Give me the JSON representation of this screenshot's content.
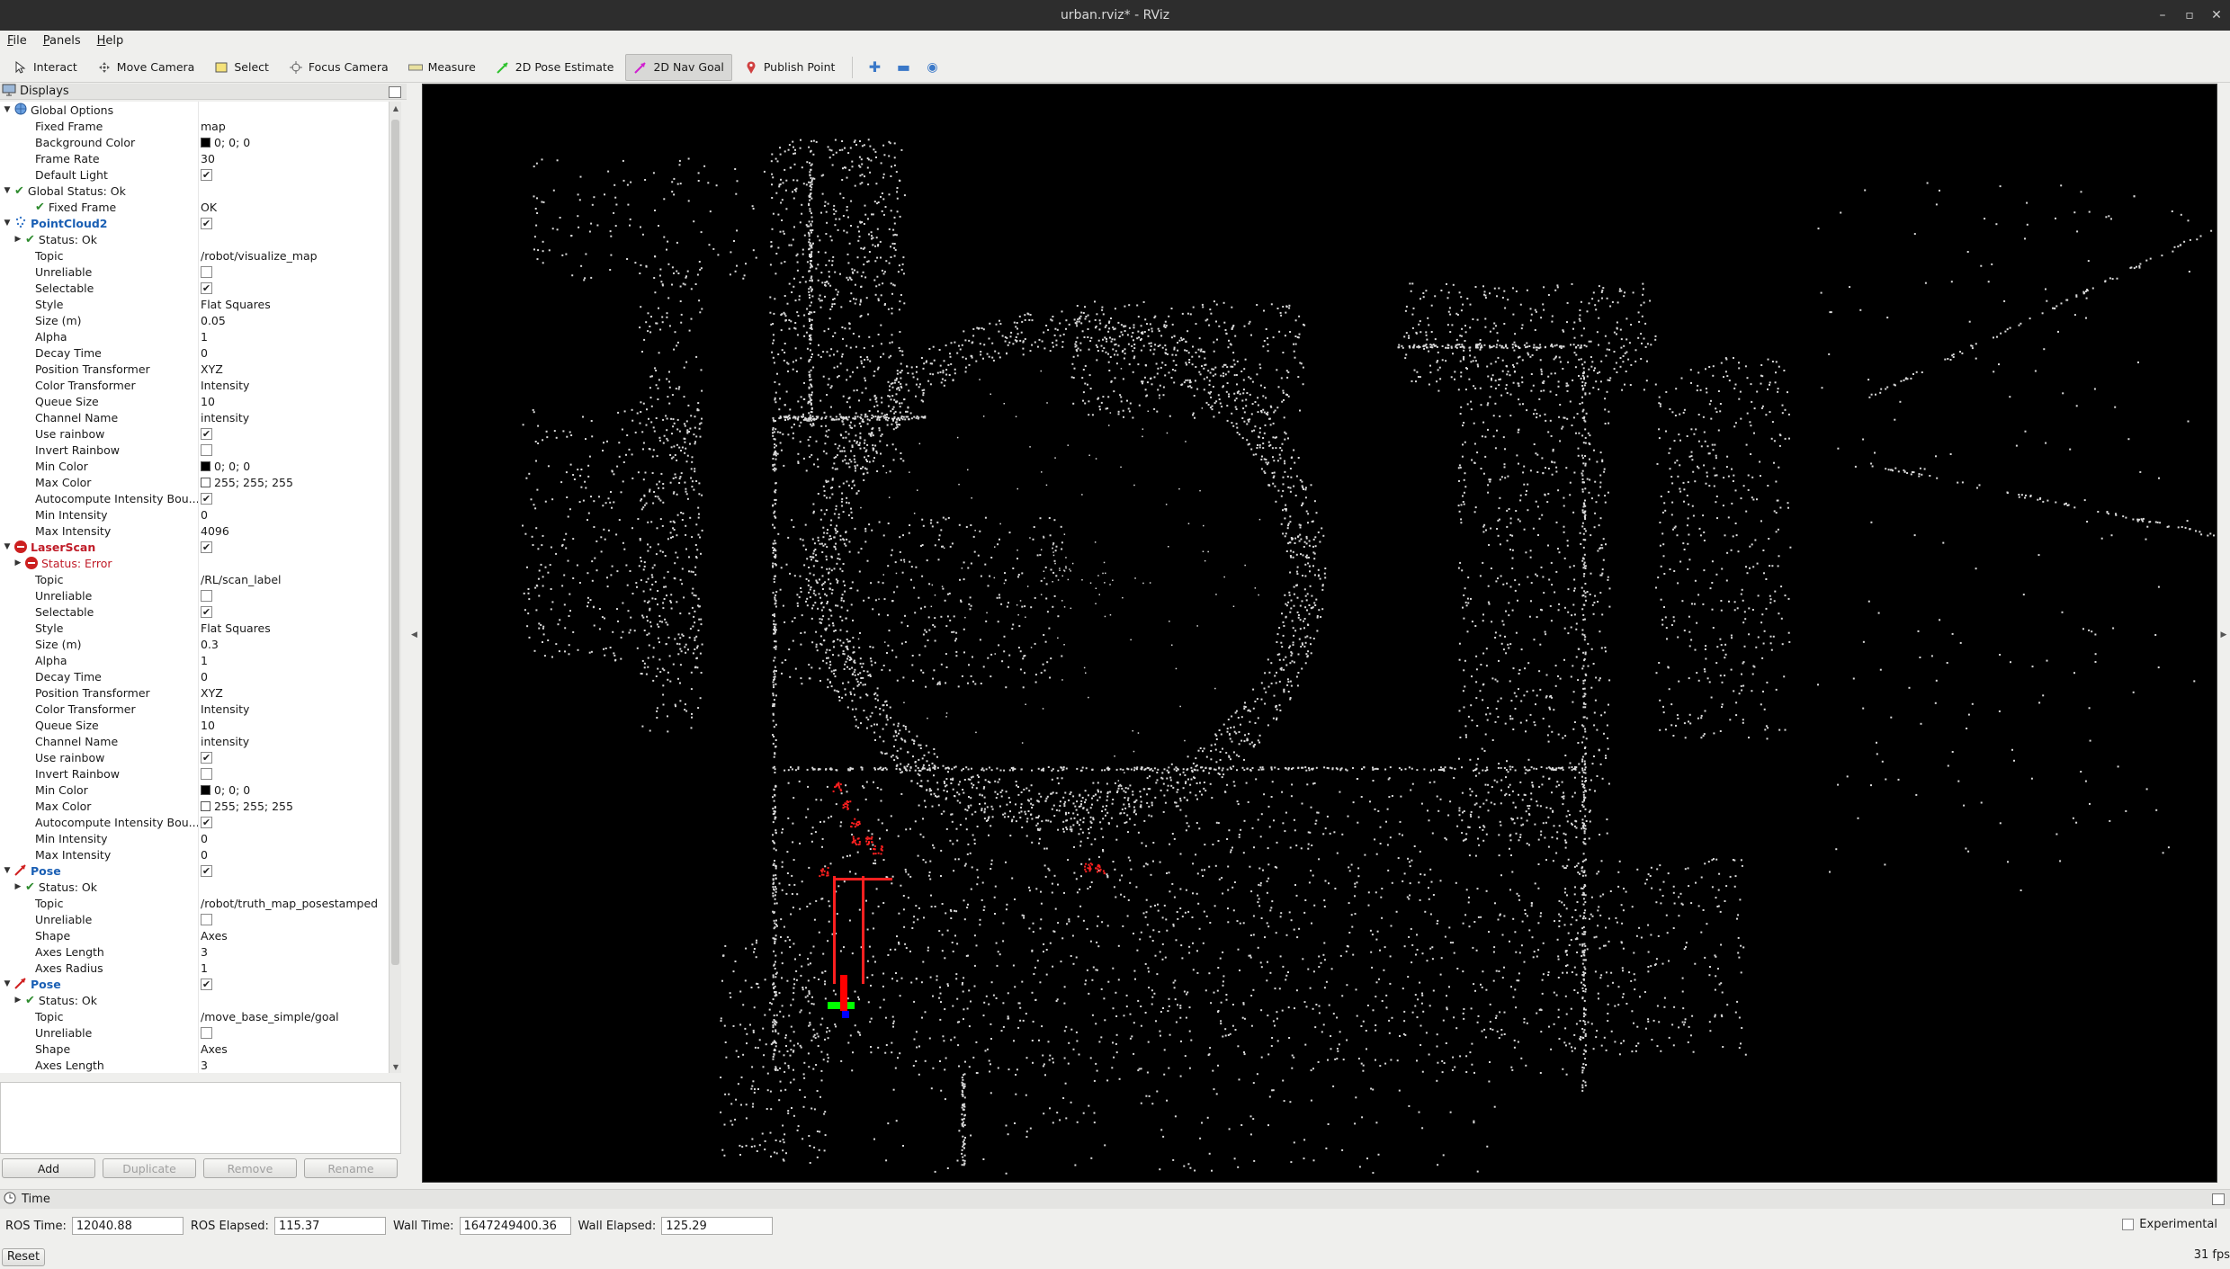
{
  "window": {
    "title": "urban.rviz* - RViz"
  },
  "menu": [
    "File",
    "Panels",
    "Help"
  ],
  "toolbar": {
    "tools": [
      {
        "label": "Interact",
        "icon": "cursor-icon",
        "active": false
      },
      {
        "label": "Move Camera",
        "icon": "move-camera-icon",
        "active": false
      },
      {
        "label": "Select",
        "icon": "select-box-icon",
        "active": false
      },
      {
        "label": "Focus Camera",
        "icon": "focus-camera-icon",
        "active": false
      },
      {
        "label": "Measure",
        "icon": "ruler-icon",
        "active": false
      },
      {
        "label": "2D Pose Estimate",
        "icon": "green-arrow-icon",
        "active": false
      },
      {
        "label": "2D Nav Goal",
        "icon": "magenta-arrow-icon",
        "active": true
      },
      {
        "label": "Publish Point",
        "icon": "map-pin-icon",
        "active": false
      }
    ]
  },
  "displays_panel": {
    "title": "Displays",
    "rows": [
      {
        "indent": 0,
        "expand": "open",
        "icon": "globe",
        "label": "Global Options",
        "style": "normal"
      },
      {
        "indent": 2,
        "label": "Fixed Frame",
        "value": "map"
      },
      {
        "indent": 2,
        "label": "Background Color",
        "value": "0; 0; 0",
        "swatch": "#000000"
      },
      {
        "indent": 2,
        "label": "Frame Rate",
        "value": "30"
      },
      {
        "indent": 2,
        "label": "Default Light",
        "check": true
      },
      {
        "indent": 0,
        "expand": "open",
        "icon": "ok",
        "label": "Global Status: Ok"
      },
      {
        "indent": 2,
        "icon": "ok",
        "label": "Fixed Frame",
        "value": "OK"
      },
      {
        "indent": 0,
        "expand": "open",
        "icon": "pointcloud",
        "label": "PointCloud2",
        "style": "blue",
        "check": true
      },
      {
        "indent": 1,
        "expand": "closed",
        "icon": "ok",
        "label": "Status: Ok"
      },
      {
        "indent": 2,
        "label": "Topic",
        "value": "/robot/visualize_map"
      },
      {
        "indent": 2,
        "label": "Unreliable",
        "check": false
      },
      {
        "indent": 2,
        "label": "Selectable",
        "check": true
      },
      {
        "indent": 2,
        "label": "Style",
        "value": "Flat Squares"
      },
      {
        "indent": 2,
        "label": "Size (m)",
        "value": "0.05"
      },
      {
        "indent": 2,
        "label": "Alpha",
        "value": "1"
      },
      {
        "indent": 2,
        "label": "Decay Time",
        "value": "0"
      },
      {
        "indent": 2,
        "label": "Position Transformer",
        "value": "XYZ"
      },
      {
        "indent": 2,
        "label": "Color Transformer",
        "value": "Intensity"
      },
      {
        "indent": 2,
        "label": "Queue Size",
        "value": "10"
      },
      {
        "indent": 2,
        "label": "Channel Name",
        "value": "intensity"
      },
      {
        "indent": 2,
        "label": "Use rainbow",
        "check": true
      },
      {
        "indent": 2,
        "label": "Invert Rainbow",
        "check": false
      },
      {
        "indent": 2,
        "label": "Min Color",
        "value": "0; 0; 0",
        "swatch": "#000000"
      },
      {
        "indent": 2,
        "label": "Max Color",
        "value": "255; 255; 255",
        "swatch": "#ffffff"
      },
      {
        "indent": 2,
        "label": "Autocompute Intensity Bou...",
        "check": true
      },
      {
        "indent": 2,
        "label": "Min Intensity",
        "value": "0"
      },
      {
        "indent": 2,
        "label": "Max Intensity",
        "value": "4096"
      },
      {
        "indent": 0,
        "expand": "open",
        "icon": "error",
        "label": "LaserScan",
        "style": "red",
        "check": true
      },
      {
        "indent": 1,
        "expand": "closed",
        "icon": "error",
        "label": "Status: Error",
        "style": "errtext"
      },
      {
        "indent": 2,
        "label": "Topic",
        "value": "/RL/scan_label"
      },
      {
        "indent": 2,
        "label": "Unreliable",
        "check": false
      },
      {
        "indent": 2,
        "label": "Selectable",
        "check": true
      },
      {
        "indent": 2,
        "label": "Style",
        "value": "Flat Squares"
      },
      {
        "indent": 2,
        "label": "Size (m)",
        "value": "0.3"
      },
      {
        "indent": 2,
        "label": "Alpha",
        "value": "1"
      },
      {
        "indent": 2,
        "label": "Decay Time",
        "value": "0"
      },
      {
        "indent": 2,
        "label": "Position Transformer",
        "value": "XYZ"
      },
      {
        "indent": 2,
        "label": "Color Transformer",
        "value": "Intensity"
      },
      {
        "indent": 2,
        "label": "Queue Size",
        "value": "10"
      },
      {
        "indent": 2,
        "label": "Channel Name",
        "value": "intensity"
      },
      {
        "indent": 2,
        "label": "Use rainbow",
        "check": true
      },
      {
        "indent": 2,
        "label": "Invert Rainbow",
        "check": false
      },
      {
        "indent": 2,
        "label": "Min Color",
        "value": "0; 0; 0",
        "swatch": "#000000"
      },
      {
        "indent": 2,
        "label": "Max Color",
        "value": "255; 255; 255",
        "swatch": "#ffffff"
      },
      {
        "indent": 2,
        "label": "Autocompute Intensity Bou...",
        "check": true
      },
      {
        "indent": 2,
        "label": "Min Intensity",
        "value": "0"
      },
      {
        "indent": 2,
        "label": "Max Intensity",
        "value": "0"
      },
      {
        "indent": 0,
        "expand": "open",
        "icon": "pose",
        "label": "Pose",
        "style": "blue",
        "check": true
      },
      {
        "indent": 1,
        "expand": "closed",
        "icon": "ok",
        "label": "Status: Ok"
      },
      {
        "indent": 2,
        "label": "Topic",
        "value": "/robot/truth_map_posestamped"
      },
      {
        "indent": 2,
        "label": "Unreliable",
        "check": false
      },
      {
        "indent": 2,
        "label": "Shape",
        "value": "Axes"
      },
      {
        "indent": 2,
        "label": "Axes Length",
        "value": "3"
      },
      {
        "indent": 2,
        "label": "Axes Radius",
        "value": "1"
      },
      {
        "indent": 0,
        "expand": "open",
        "icon": "pose",
        "label": "Pose",
        "style": "blue",
        "check": true
      },
      {
        "indent": 1,
        "expand": "closed",
        "icon": "ok",
        "label": "Status: Ok"
      },
      {
        "indent": 2,
        "label": "Topic",
        "value": "/move_base_simple/goal"
      },
      {
        "indent": 2,
        "label": "Unreliable",
        "check": false
      },
      {
        "indent": 2,
        "label": "Shape",
        "value": "Axes"
      },
      {
        "indent": 2,
        "label": "Axes Length",
        "value": "3"
      }
    ],
    "buttons": [
      {
        "label": "Add",
        "enabled": true
      },
      {
        "label": "Duplicate",
        "enabled": false
      },
      {
        "label": "Remove",
        "enabled": false
      },
      {
        "label": "Rename",
        "enabled": false
      }
    ]
  },
  "time_panel": {
    "title": "Time",
    "ros_time_label": "ROS Time:",
    "ros_time": "12040.88",
    "ros_elapsed_label": "ROS Elapsed:",
    "ros_elapsed": "115.37",
    "wall_time_label": "Wall Time:",
    "wall_time": "1647249400.36",
    "wall_elapsed_label": "Wall Elapsed:",
    "wall_elapsed": "125.29",
    "experimental_label": "Experimental"
  },
  "status": {
    "reset_label": "Reset",
    "fps": "31 fps"
  },
  "colors": {
    "pointcloud": "#d9d9d9",
    "laserscan": "#ff2020",
    "pose_x": "#ff0000",
    "pose_y": "#00ff00",
    "pose_z": "#0000ff",
    "active_tool": "#d8d8d6"
  }
}
